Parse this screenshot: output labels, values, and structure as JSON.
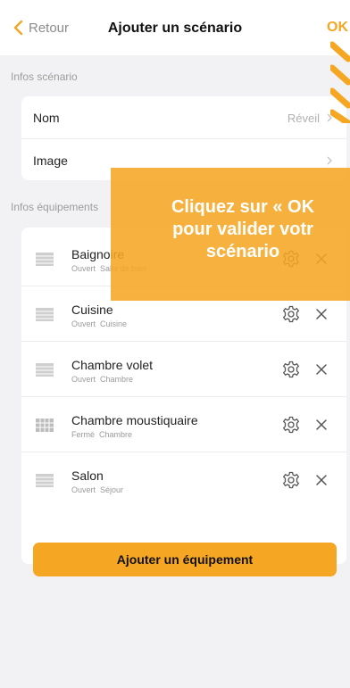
{
  "navbar": {
    "back_label": "Retour",
    "title": "Ajouter un scénario",
    "ok_label": "OK"
  },
  "infos_scenario": {
    "section_label": "Infos scénario",
    "name_label": "Nom",
    "name_value": "Réveil",
    "image_label": "Image"
  },
  "infos_equipements": {
    "section_label": "Infos équipements",
    "items": [
      {
        "name": "Baignoire",
        "state": "Ouvert",
        "room": "Salle de bain",
        "icon": "shutter-icon"
      },
      {
        "name": "Cuisine",
        "state": "Ouvert",
        "room": "Cuisine",
        "icon": "shutter-icon"
      },
      {
        "name": "Chambre volet",
        "state": "Ouvert",
        "room": "Chambre",
        "icon": "shutter-icon"
      },
      {
        "name": "Chambre moustiquaire",
        "state": "Fermé",
        "room": "Chambre",
        "icon": "mosquito-net-icon"
      },
      {
        "name": "Salon",
        "state": "Ouvert",
        "room": "Séjour",
        "icon": "shutter-icon"
      }
    ],
    "add_button_label": "Ajouter un équipement"
  },
  "tutorial": {
    "text": "Cliquez sur « OK\npour valider votr\nscénario"
  },
  "colors": {
    "accent": "#f5a623",
    "background": "#f2f2f4"
  }
}
